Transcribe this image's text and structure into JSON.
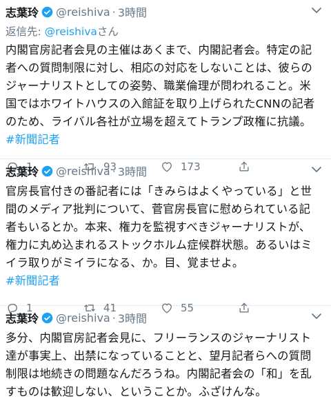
{
  "tweets": [
    {
      "name": "志葉玲",
      "handle": "@reishiva",
      "dot": "·",
      "time": "3時間",
      "reply_prefix": "返信先: ",
      "reply_handle": "@reishiva",
      "reply_suffix": "さん",
      "lines": [
        "内閣官房記者会見の主催はあくまで、内閣記者会。特定の記",
        "者への質問制限に対し、相応の対応をしないことは、彼らの",
        "ジャーナリストとしての姿勢、職業倫理が問われること。米",
        "国ではホワイトハウスの入館証を取り上げられたCNNの記者",
        "のため、ライバル各社が立場を超えてトランプ政権に抗議。"
      ],
      "hashtag": "#新聞記者",
      "replies": "1",
      "retweets": "93",
      "likes": "173"
    },
    {
      "name": "志葉玲",
      "handle": "@reishiva",
      "dot": "·",
      "time": "3時間",
      "lines": [
        "官房長官付きの番記者には「きみらはよくやっている」と世",
        "間のメディア批判について、菅官房長官に慰められている記",
        "者もいるとか。本来、権力を監視すべきジャーナリストが、",
        "権力に丸め込まれるストックホルム症候群状態。あるいはミ",
        "イラ取りがミイラになる、か。目、覚ませよ。"
      ],
      "hashtag": "#新聞記者",
      "replies": "1",
      "retweets": "41",
      "likes": "55"
    },
    {
      "name": "志葉玲",
      "handle": "@reishiva",
      "dot": "·",
      "time": "3時間",
      "lines": [
        "多分、内閣官房記者会見に、フリーランスのジャーナリスト",
        "達が事実上、出禁になっていることと、望月記者らへの質問",
        "制限は地続きの問題なんだろうね。内閣記者会の「和」を乱",
        "すものは歓迎しない、ということか。ふざけんな。"
      ]
    }
  ],
  "colors": {
    "accent": "#1da1f2",
    "muted": "#657786",
    "text": "#14171a"
  },
  "icons": [
    "verified-badge-icon",
    "chevron-down-icon",
    "reply-icon",
    "retweet-icon",
    "like-icon",
    "share-icon"
  ]
}
